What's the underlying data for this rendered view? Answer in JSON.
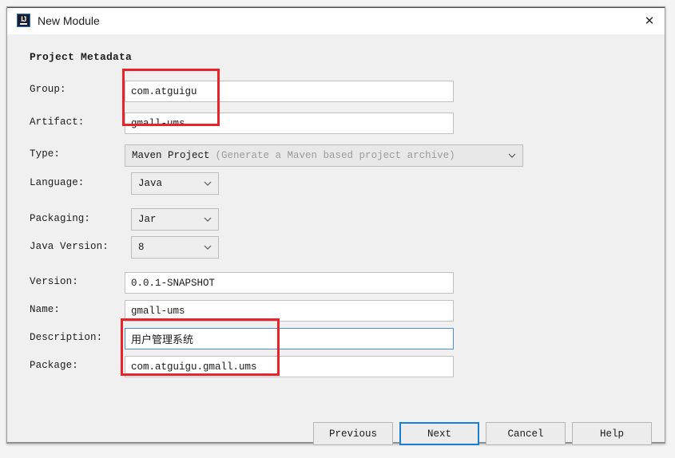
{
  "window": {
    "title": "New Module",
    "app_icon": "intellij-idea-icon",
    "close_icon": "✕"
  },
  "form": {
    "section_title": "Project Metadata",
    "fields": [
      {
        "label": "Group:",
        "value": "com.atguigu"
      },
      {
        "label": "Artifact:",
        "value": "gmall-ums"
      },
      {
        "label": "Type:",
        "value": "Maven Project",
        "hint": "(Generate a Maven based project archive)"
      },
      {
        "label": "Language:",
        "value": "Java"
      },
      {
        "label": "Packaging:",
        "value": "Jar"
      },
      {
        "label": "Java Version:",
        "value": "8"
      },
      {
        "label": "Version:",
        "value": "0.0.1-SNAPSHOT"
      },
      {
        "label": "Name:",
        "value": "gmall-ums"
      },
      {
        "label": "Description:",
        "value": "用户管理系统"
      },
      {
        "label": "Package:",
        "value": "com.atguigu.gmall.ums"
      }
    ]
  },
  "buttons": {
    "previous": "Previous",
    "next": "Next",
    "cancel": "Cancel",
    "help": "Help"
  },
  "annotations": {
    "color": "#e8242a",
    "focus_color": "#4a90d9",
    "default_button_color": "#1a7fd4"
  }
}
